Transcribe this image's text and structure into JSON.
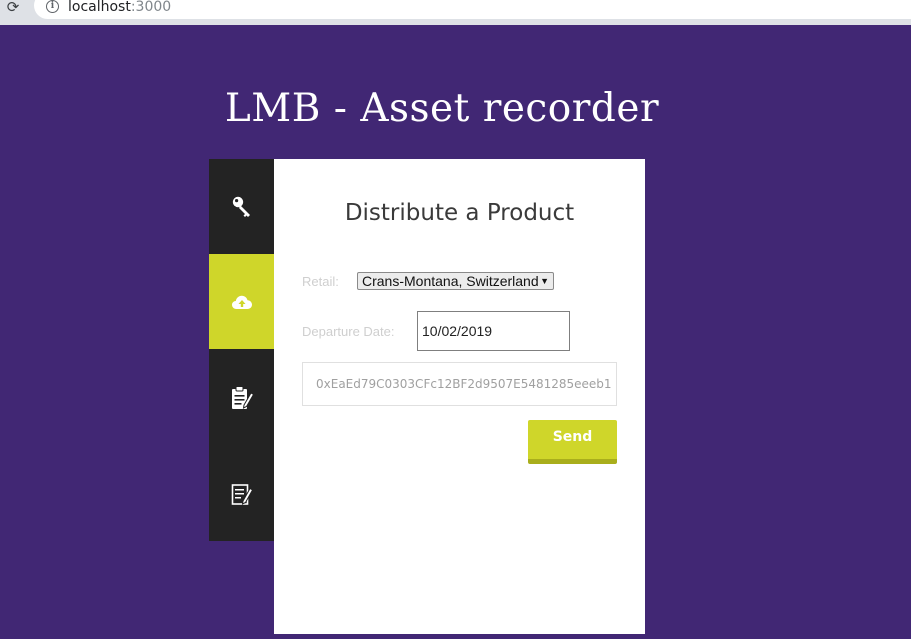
{
  "browser": {
    "url_host": "localhost",
    "url_port": ":3000",
    "reload_icon": "reload-icon",
    "info_icon": "info-icon"
  },
  "header": {
    "title": "LMB - Asset recorder"
  },
  "menu": {
    "items": [
      {
        "icon": "key-icon",
        "active": false
      },
      {
        "icon": "cloud-upload-icon",
        "active": true
      },
      {
        "icon": "clipboard-edit-icon",
        "active": false
      },
      {
        "icon": "notepad-edit-icon",
        "active": false
      }
    ]
  },
  "form": {
    "heading": "Distribute a Product",
    "retail_label": "Retail:",
    "retail_value": "Crans-Montana, Switzerland",
    "departure_label": "Departure Date:",
    "departure_value": "10/02/2019",
    "address_value": "0xEaEd79C0303CFc12BF2d9507E5481285eeeb1",
    "send_label": "Send"
  },
  "colors": {
    "background": "#412774",
    "accent": "#cfd62a",
    "menu": "#232323"
  }
}
